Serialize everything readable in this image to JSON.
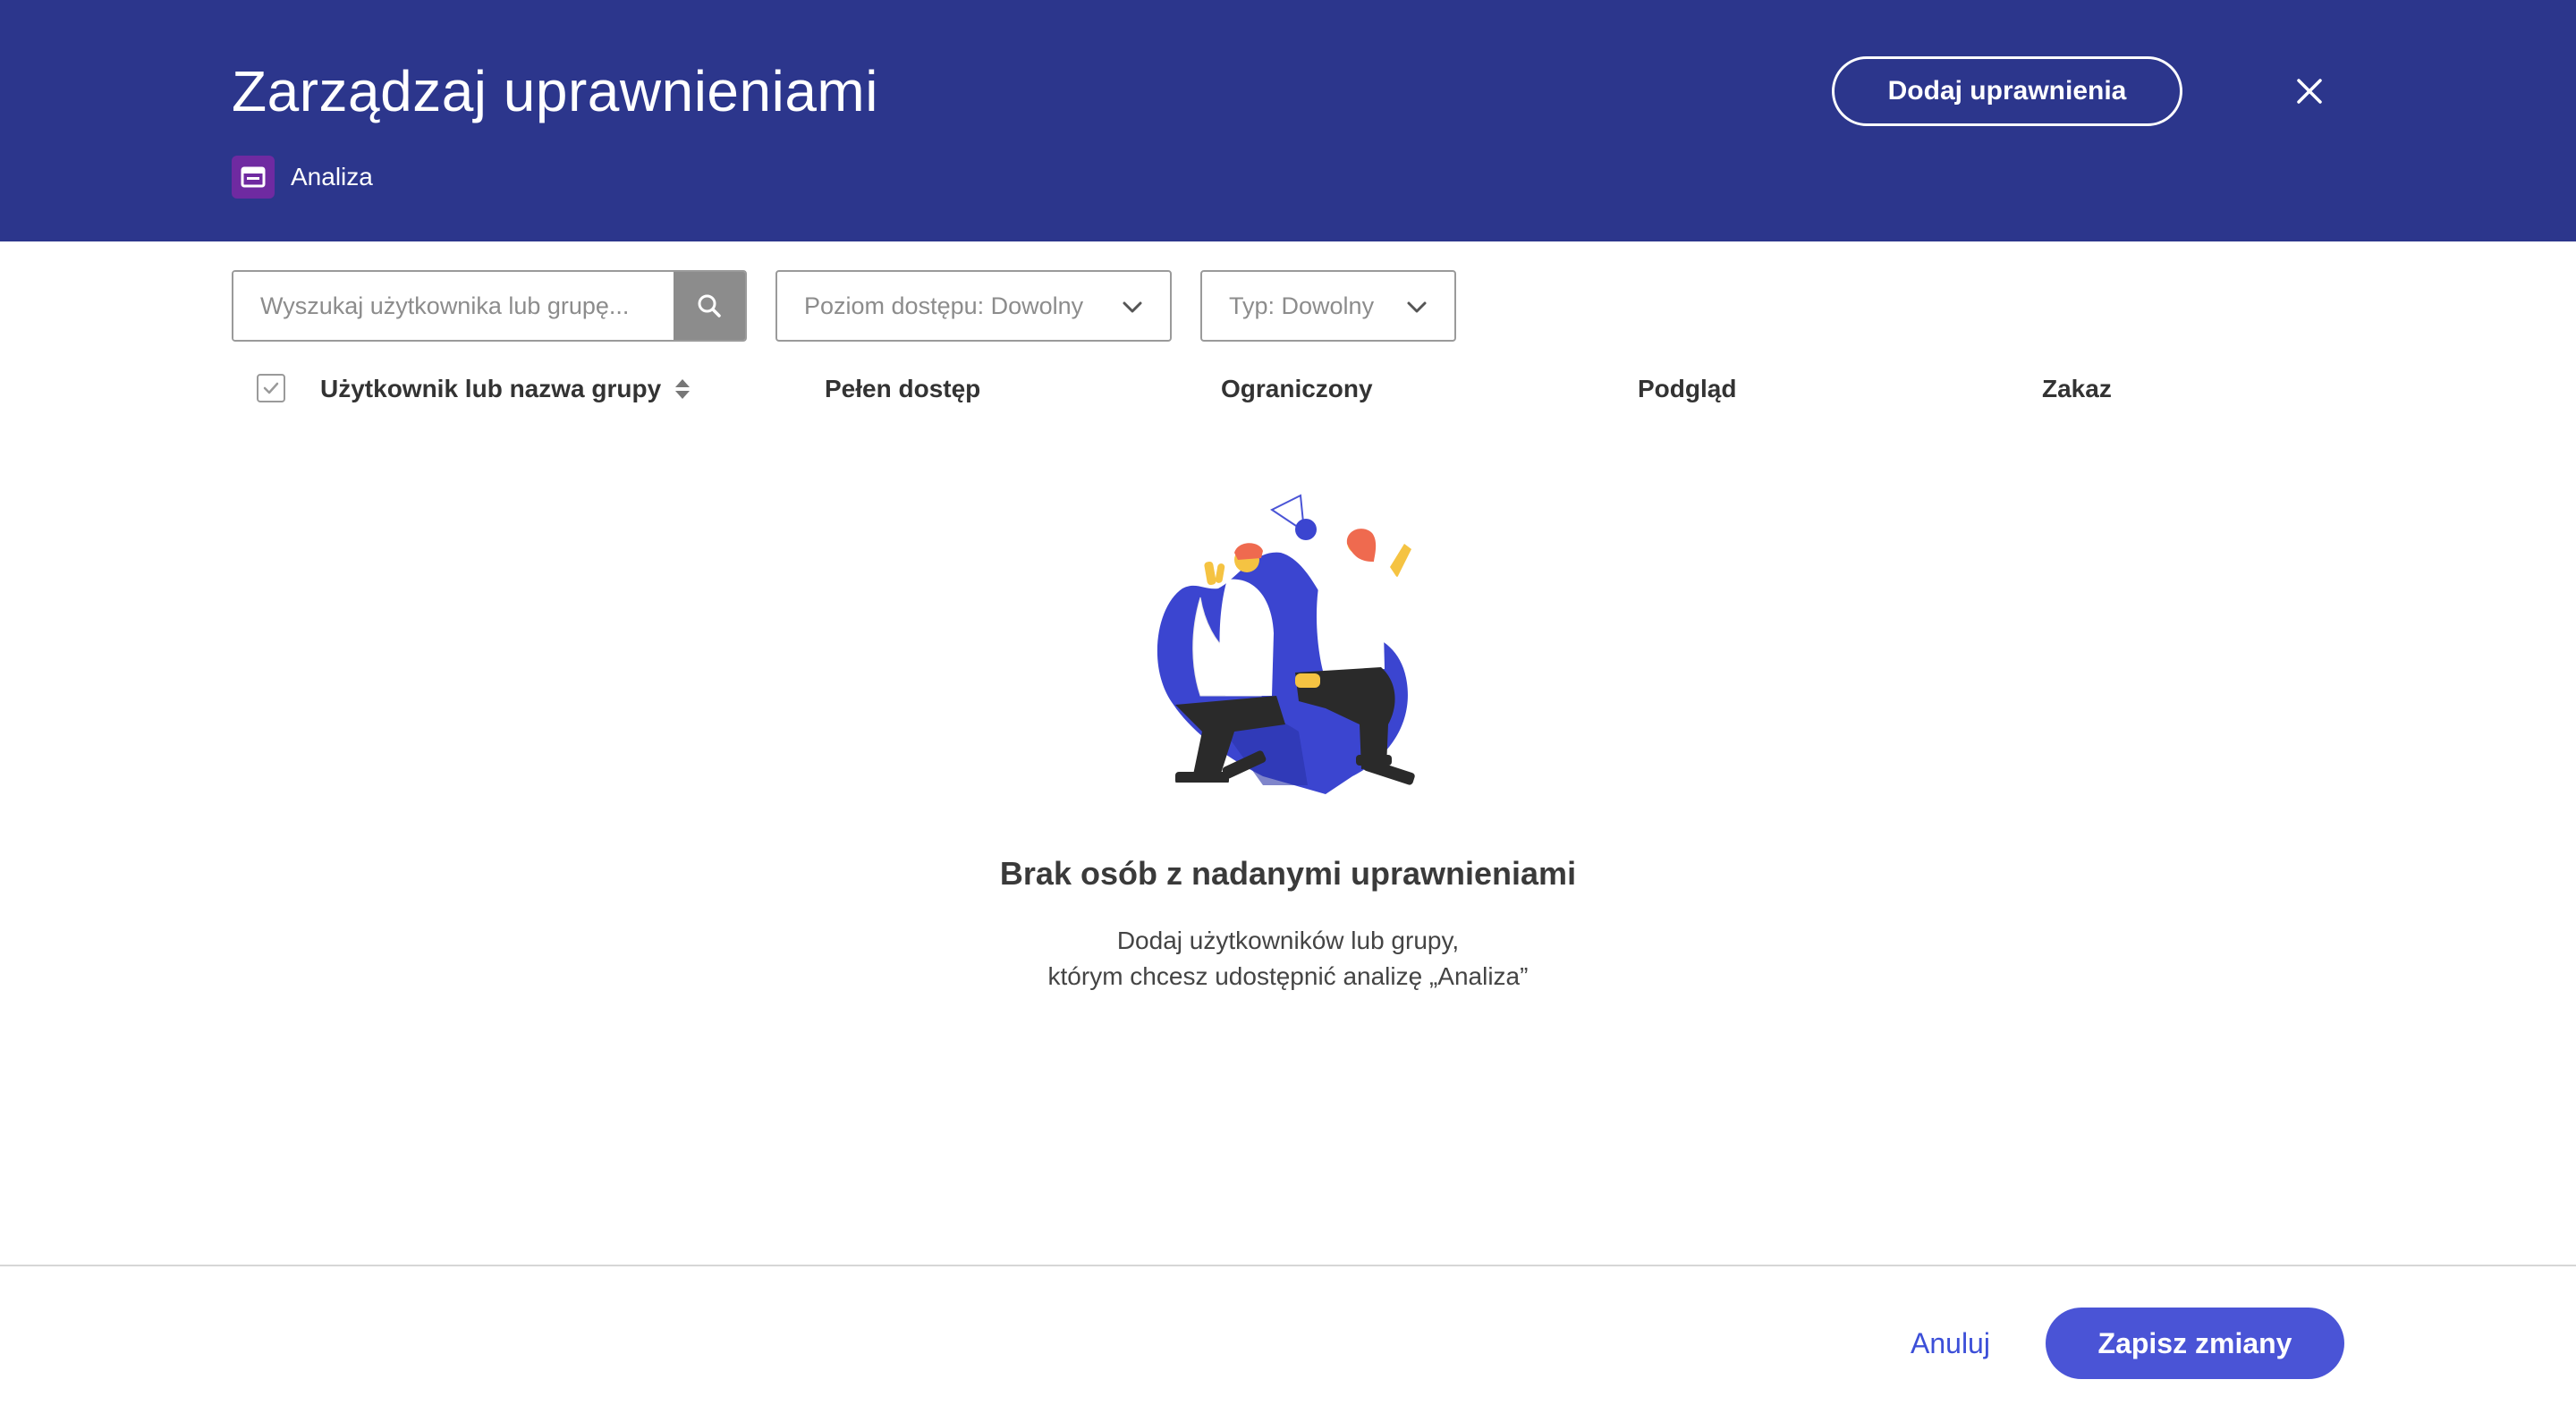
{
  "header": {
    "title": "Zarządzaj uprawnieniami",
    "breadcrumb_icon": "dashboard-icon",
    "breadcrumb_label": "Analiza",
    "add_button_label": "Dodaj uprawnienia",
    "close_icon": "close-icon"
  },
  "filters": {
    "search_placeholder": "Wyszukaj użytkownika lub grupę...",
    "search_value": "",
    "search_icon": "search-icon",
    "access_level": "Poziom dostępu: Dowolny",
    "type": "Typ: Dowolny"
  },
  "table": {
    "columns": [
      "Użytkownik lub nazwa grupy",
      "Pełen dostęp",
      "Ograniczony",
      "Podgląd",
      "Zakaz"
    ]
  },
  "empty_state": {
    "title": "Brak osób z nadanymi uprawnieniami",
    "line1": "Dodaj użytkowników lub grupy,",
    "line2": "którym chcesz udostępnić analizę „Analiza”"
  },
  "footer": {
    "cancel_label": "Anuluj",
    "save_label": "Zapisz zmiany"
  },
  "colors": {
    "header_bg": "#2c368c",
    "accent": "#4a54d6",
    "link": "#3c4fd8",
    "breadcrumb_icon_bg": "#6f2aa1"
  }
}
